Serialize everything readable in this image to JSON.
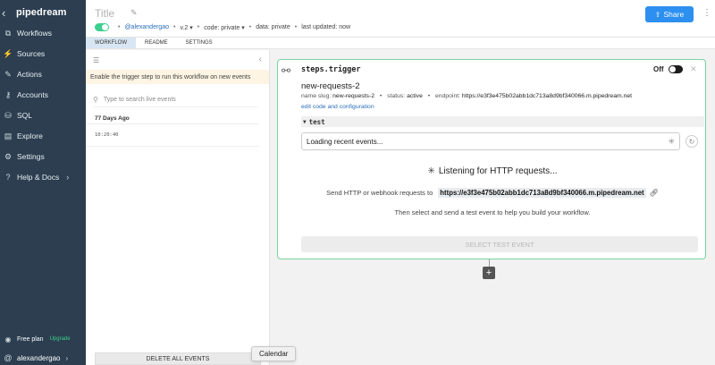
{
  "sidebar": {
    "brand": "pipedream",
    "items": [
      {
        "label": "Workflows",
        "icon": "workflows-icon"
      },
      {
        "label": "Sources",
        "icon": "sources-icon"
      },
      {
        "label": "Actions",
        "icon": "actions-icon"
      },
      {
        "label": "Accounts",
        "icon": "accounts-icon"
      },
      {
        "label": "SQL",
        "icon": "database-icon"
      },
      {
        "label": "Explore",
        "icon": "explore-icon"
      },
      {
        "label": "Settings",
        "icon": "gear-icon"
      },
      {
        "label": "Help & Docs",
        "icon": "help-icon"
      }
    ],
    "plan": "Free plan",
    "upgrade": "Upgrade",
    "username": "alexandergao"
  },
  "header": {
    "title": "Title",
    "user": "@alexandergao",
    "version": "v.2",
    "code": "code: private",
    "data": "data: private",
    "last_updated": "last updated: now",
    "share": "Share"
  },
  "tabs": [
    "WORKFLOW",
    "README",
    "SETTINGS"
  ],
  "events_panel": {
    "notice": "Enable the trigger step to run this workflow on new events",
    "search_placeholder": "Type to search live events",
    "group_label": "77 Days Ago",
    "event_time": "10:20:40",
    "delete_all": "DELETE ALL EVENTS"
  },
  "tooltip": "Calendar",
  "trigger": {
    "heading": "steps.trigger",
    "toggle_label": "Off",
    "source_name": "new-requests-2",
    "slug_label": "name slug:",
    "slug": "new-requests-2",
    "status_label": "status:",
    "status": "active",
    "endpoint_label": "endpoint:",
    "endpoint": "https://e3f3e475b02abb1dc713a8d9bf340066.m.pipedream.net",
    "edit_link": "edit code and configuration",
    "test_label": "test",
    "loading": "Loading recent events...",
    "listening": "Listening for HTTP requests...",
    "send_text": "Send HTTP or webhook requests to",
    "then_text": "Then select and send a test event to help you build your workflow.",
    "select_button": "SELECT TEST EVENT"
  },
  "colors": {
    "sidebar_bg": "#2c3e50",
    "accent_green": "#3ecf8e",
    "share_blue": "#2d8ff0",
    "card_border": "#7ad3a2"
  }
}
